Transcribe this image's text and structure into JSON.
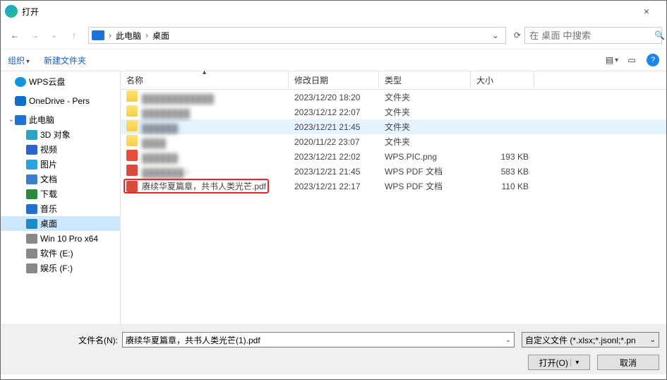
{
  "window": {
    "title": "打开",
    "close": "×"
  },
  "breadcrumb": {
    "seg1": "此电脑",
    "seg2": "桌面",
    "chevron": "›"
  },
  "search": {
    "placeholder": "在 桌面 中搜索"
  },
  "toolbar": {
    "organize": "组织",
    "new_folder": "新建文件夹"
  },
  "sidebar": {
    "wps": "WPS云盘",
    "onedrive": "OneDrive - Pers",
    "thispc": "此电脑",
    "objects3d": "3D 对象",
    "videos": "视频",
    "pictures": "图片",
    "documents": "文档",
    "downloads": "下载",
    "music": "音乐",
    "desktop": "桌面",
    "win10": "Win 10 Pro x64",
    "soft": "软件 (E:)",
    "ent": "娱乐 (F:)"
  },
  "columns": {
    "name": "名称",
    "date": "修改日期",
    "type": "类型",
    "size": "大小"
  },
  "rows": [
    {
      "name": "████████████",
      "date": "2023/12/20 18:20",
      "type": "文件夹",
      "size": "",
      "icon": "folder",
      "blur": true
    },
    {
      "name": "████████",
      "date": "2023/12/12 22:07",
      "type": "文件夹",
      "size": "",
      "icon": "folder",
      "blur": true
    },
    {
      "name": "██████",
      "date": "2023/12/21 21:45",
      "type": "文件夹",
      "size": "",
      "icon": "folder",
      "blur": true,
      "active": true
    },
    {
      "name": "████",
      "date": "2020/11/22 23:07",
      "type": "文件夹",
      "size": "",
      "icon": "folder",
      "blur": true
    },
    {
      "name": "██████",
      "date": "2023/12/21 22:02",
      "type": "WPS.PIC.png",
      "size": "193 KB",
      "icon": "png",
      "blur": true
    },
    {
      "name": "███████ f",
      "date": "2023/12/21 21:45",
      "type": "WPS PDF 文档",
      "size": "583 KB",
      "icon": "pdf",
      "blur": true
    },
    {
      "name": "赓续华夏篇章，共书人类光芒.pdf",
      "date": "2023/12/21 22:17",
      "type": "WPS PDF 文档",
      "size": "110 KB",
      "icon": "pdf",
      "blur": false,
      "highlighted": true
    }
  ],
  "bottom": {
    "file_label": "文件名(N):",
    "file_value": "赓续华夏篇章，共书人类光芒(1).pdf",
    "filter": "自定义文件 (*.xlsx;*.jsonl;*.pn",
    "open": "打开(O)",
    "cancel": "取消"
  }
}
